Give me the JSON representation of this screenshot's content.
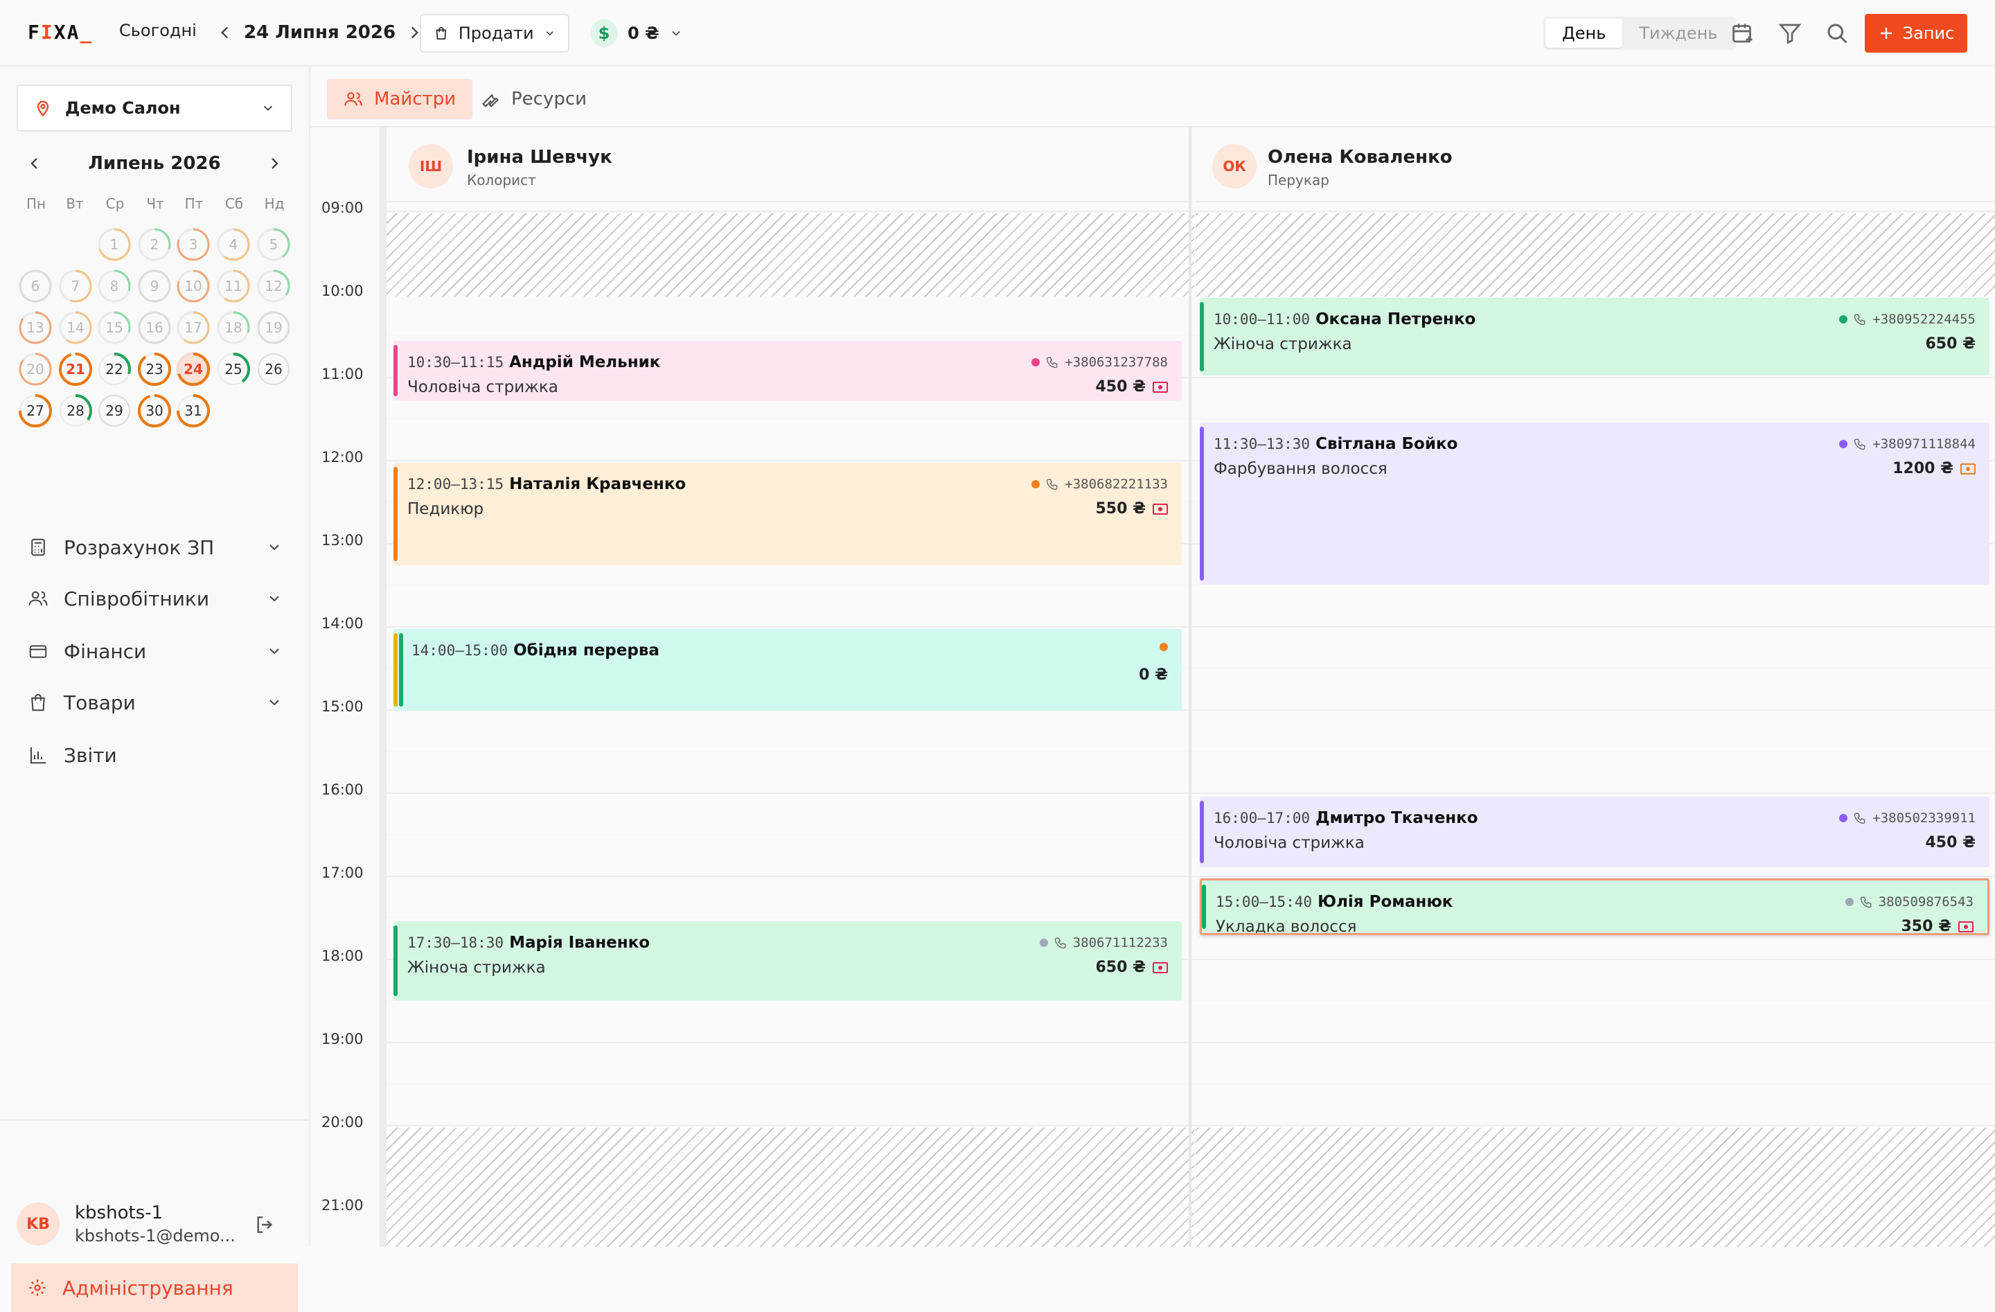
{
  "topbar": {
    "logo": {
      "f": "F",
      "i": "I",
      "xa": "XA",
      "u": "_"
    },
    "today_label": "Сьогодні",
    "date_label": "24 Липня 2026",
    "sell_label": "Продати",
    "balance": "0 ₴",
    "view_day": "День",
    "view_week": "Тиждень",
    "add_label": "Запис"
  },
  "sidebar": {
    "salon": "Демо Салон",
    "calendar": {
      "month_label": "Липень 2026",
      "weekdays": [
        "Пн",
        "Вт",
        "Ср",
        "Чт",
        "Пт",
        "Сб",
        "Нд"
      ],
      "days": [
        "1",
        "2",
        "3",
        "4",
        "5",
        "6",
        "7",
        "8",
        "9",
        "10",
        "11",
        "12",
        "13",
        "14",
        "15",
        "16",
        "17",
        "18",
        "19",
        "20",
        "21",
        "22",
        "23",
        "24",
        "25",
        "26",
        "27",
        "28",
        "29",
        "30",
        "31"
      ]
    },
    "menu": [
      {
        "label": "Розрахунок ЗП",
        "icon": "calculator-icon"
      },
      {
        "label": "Співробітники",
        "icon": "users-icon"
      },
      {
        "label": "Фінанси",
        "icon": "credit-card-icon"
      },
      {
        "label": "Товари",
        "icon": "shopping-bag-icon"
      },
      {
        "label": "Звіти",
        "icon": "bar-chart-icon"
      }
    ],
    "user": {
      "initials": "KB",
      "name": "kbshots-1",
      "email": "kbshots-1@demo..."
    },
    "admin_label": "Адміністрування"
  },
  "tabs": {
    "masters": "Майстри",
    "resources": "Ресурси"
  },
  "masters": [
    {
      "initials": "ІШ",
      "name": "Ірина Шевчук",
      "role": "Колорист"
    },
    {
      "initials": "ОК",
      "name": "Олена Коваленко",
      "role": "Перукар"
    }
  ],
  "hours": [
    "09:00",
    "10:00",
    "11:00",
    "12:00",
    "13:00",
    "14:00",
    "15:00",
    "16:00",
    "17:00",
    "18:00",
    "19:00",
    "20:00",
    "21:00"
  ],
  "colors": {
    "accent": "#f04a1e",
    "pink": "#fde6f1",
    "orange": "#ffeed8",
    "teal": "#cff9ee",
    "green": "#d4f7e2",
    "lavender": "#ece9fd"
  },
  "appointments": [
    {
      "time": "10:30–11:15",
      "name": "Андрій Мельник",
      "phone": "+380631237788",
      "service": "Чоловіча стрижка",
      "price": "450 ₴"
    },
    {
      "time": "12:00–13:15",
      "name": "Наталія Кравченко",
      "phone": "+380682221133",
      "service": "Педикюр",
      "price": "550 ₴"
    },
    {
      "time": "14:00–15:00",
      "name": "Обідня перерва",
      "price": "0 ₴"
    },
    {
      "time": "17:30–18:30",
      "name": "Марія Іваненко",
      "phone": "380671112233",
      "service": "Жіноча стрижка",
      "price": "650 ₴"
    },
    {
      "time": "10:00–11:00",
      "name": "Оксана Петренко",
      "phone": "+380952224455",
      "service": "Жіноча стрижка",
      "price": "650 ₴"
    },
    {
      "time": "11:30–13:30",
      "name": "Світлана Бойко",
      "phone": "+380971118844",
      "service": "Фарбування волосся",
      "price": "1200 ₴"
    },
    {
      "time": "16:00–17:00",
      "name": "Дмитро Ткаченко",
      "phone": "+380502339911",
      "service": "Чоловіча стрижка",
      "price": "450 ₴"
    },
    {
      "time": "15:00–15:40",
      "name": "Юлія Романюк",
      "phone": "380509876543",
      "service": "Укладка волосся",
      "price": "350 ₴"
    }
  ]
}
